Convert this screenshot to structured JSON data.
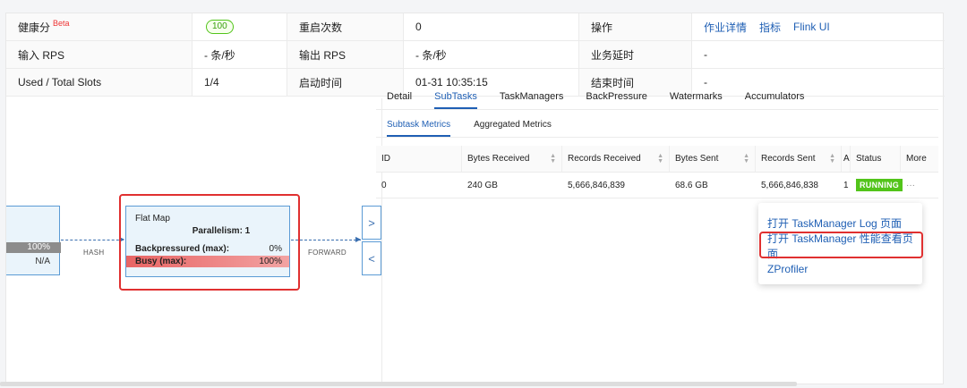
{
  "info": {
    "rows": [
      [
        {
          "label": "健康分",
          "beta": "Beta"
        },
        {
          "badge": "100"
        },
        {
          "label": "重启次数"
        },
        {
          "value": "0"
        },
        {
          "label": "操作"
        },
        {
          "links": [
            "作业详情",
            "指标",
            "Flink UI"
          ]
        }
      ],
      [
        {
          "label": "输入 RPS"
        },
        {
          "value": "- 条/秒"
        },
        {
          "label": "输出 RPS"
        },
        {
          "value": "- 条/秒"
        },
        {
          "label": "业务延时"
        },
        {
          "value": "-"
        }
      ],
      [
        {
          "label": "Used / Total Slots"
        },
        {
          "value": "1/4"
        },
        {
          "label": "启动时间"
        },
        {
          "value": "01-31 10:35:15"
        },
        {
          "label": "结束时间"
        },
        {
          "value": "-"
        }
      ]
    ]
  },
  "graph": {
    "left_node": {
      "pct": "100%",
      "na": "N/A",
      "tick": "l"
    },
    "edge_hash": "HASH",
    "edge_forward": "FORWARD",
    "flat_map": {
      "title": "Flat Map",
      "parallelism": "Parallelism: 1",
      "backpressured_label": "Backpressured (max):",
      "backpressured_value": "0%",
      "busy_label": "Busy (max):",
      "busy_value": "100%",
      "busy_fraction": 1.0
    },
    "collapse_right": ">",
    "collapse_left": "<"
  },
  "tabs": [
    "Detail",
    "SubTasks",
    "TaskManagers",
    "BackPressure",
    "Watermarks",
    "Accumulators"
  ],
  "active_tab": "SubTasks",
  "subtabs": [
    "Subtask Metrics",
    "Aggregated Metrics"
  ],
  "active_subtab": "Subtask Metrics",
  "table": {
    "headers": [
      "ID",
      "Bytes Received",
      "Records Received",
      "Bytes Sent",
      "Records Sent",
      "A",
      "Status",
      "More"
    ],
    "rows": [
      {
        "id": "0",
        "bytes_received": "240 GB",
        "records_received": "5,666,846,839",
        "bytes_sent": "68.6 GB",
        "records_sent": "5,666,846,838",
        "a": "1",
        "status": "RUNNING",
        "more": "···"
      }
    ]
  },
  "menu": {
    "items": [
      "打开 TaskManager Log 页面",
      "打开 TaskManager 性能查看页面",
      "ZProfiler"
    ]
  },
  "colors": {
    "accent": "#1f5fb4",
    "running": "#52c41a",
    "highlight": "#e03030",
    "busy": "#e86464"
  }
}
